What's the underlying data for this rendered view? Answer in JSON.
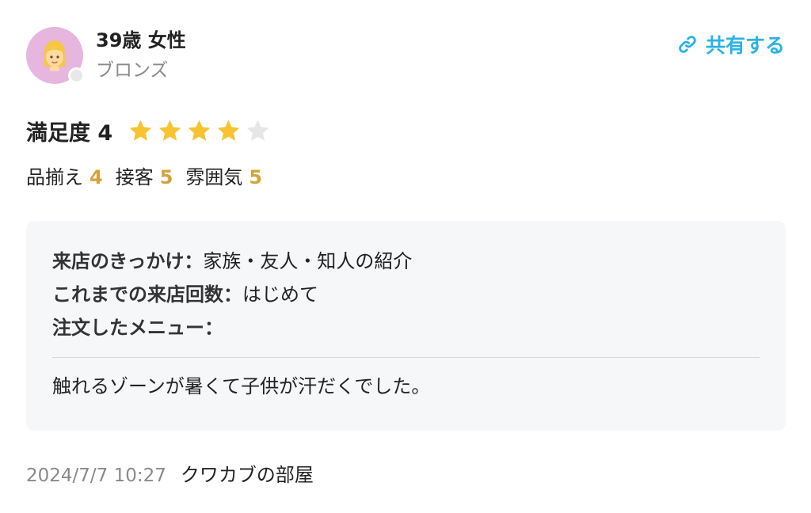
{
  "user": {
    "name": "39歳 女性",
    "rank": "ブロンズ",
    "avatar_icon": "woman-emoji-icon"
  },
  "share": {
    "label": "共有する",
    "icon": "link-icon",
    "color": "#2bb3e3"
  },
  "rating": {
    "label": "満足度 4",
    "value": 4,
    "max": 5,
    "star_color": "#f7c331",
    "empty_star_color": "#e6e6e6"
  },
  "sub_ratings": [
    {
      "label": "品揃え",
      "score": "4"
    },
    {
      "label": "接客",
      "score": "5"
    },
    {
      "label": "雰囲気",
      "score": "5"
    }
  ],
  "details": {
    "trigger_label": "来店のきっかけ：",
    "trigger_value": "家族・友人・知人の紹介",
    "visits_label": "これまでの来店回数：",
    "visits_value": "はじめて",
    "menu_label": "注文したメニュー：",
    "menu_value": "",
    "comment": "触れるゾーンが暑くて子供が汗だくでした。"
  },
  "footer": {
    "date": "2024/7/7 10:27",
    "shop": "クワカブの部屋"
  }
}
